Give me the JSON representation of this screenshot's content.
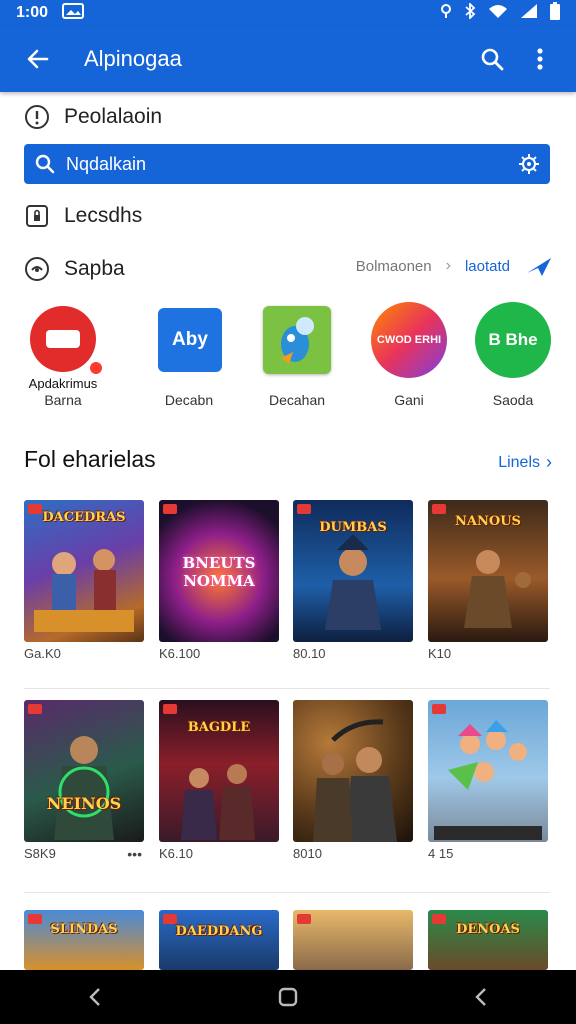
{
  "status": {
    "time": "1:00"
  },
  "appbar": {
    "title": "Alpinogaa"
  },
  "rows": {
    "row1": "Peolalaoin",
    "row3": "Lecsdhs",
    "row4": "Sapba"
  },
  "search": {
    "value": "Nqdalkain"
  },
  "sort": {
    "option1": "Bolmaonen",
    "option2": "laotatd"
  },
  "apps": [
    {
      "label": "Barna",
      "overlay": "Apdakrimus"
    },
    {
      "label": "Decabn",
      "logo": "Aby"
    },
    {
      "label": "Decahan"
    },
    {
      "label": "Gani",
      "logo": "CWOD ERHI"
    },
    {
      "label": "Saoda",
      "logo": "B Bhe"
    }
  ],
  "section": {
    "title": "Fol eharielas",
    "see_all": "Linels"
  },
  "games": [
    {
      "title": "DACEDRAS",
      "price": "Ga.K0"
    },
    {
      "title": "BNEUTS NOMMA",
      "price": "K6.100"
    },
    {
      "title": "DUMBAS",
      "price": "80.10"
    },
    {
      "title": "NANOUS",
      "price": "K10"
    },
    {
      "title": "NEINOS",
      "price": "S8K9"
    },
    {
      "title": "BAGDLE",
      "price": "K6.10"
    },
    {
      "title": "",
      "price": "8010"
    },
    {
      "title": "",
      "price": "4 15"
    },
    {
      "title": "SLINDAS",
      "price": ""
    },
    {
      "title": "DAEDDANG",
      "price": ""
    },
    {
      "title": "",
      "price": ""
    },
    {
      "title": "DENOAS",
      "price": ""
    }
  ],
  "colors": {
    "primary": "#1565d8"
  }
}
